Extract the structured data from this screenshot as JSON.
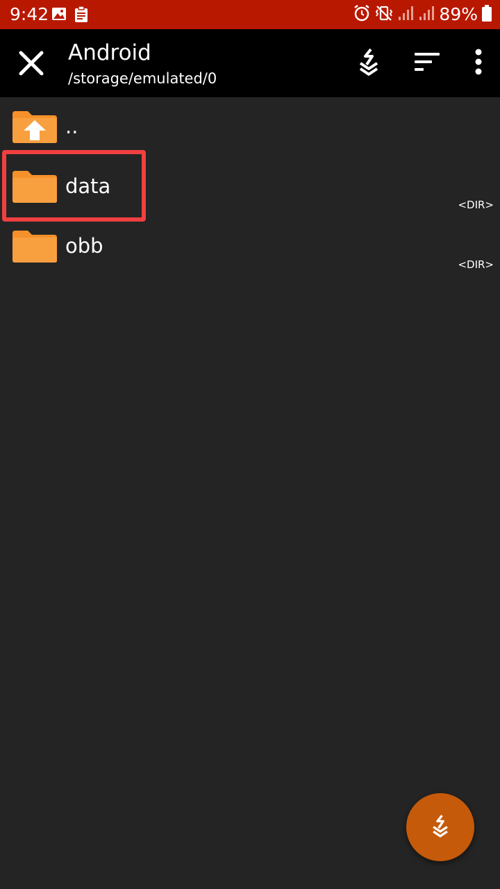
{
  "status_bar": {
    "time": "9:42",
    "battery": "89%",
    "left_icons": [
      "image-icon",
      "clipboard-icon"
    ],
    "right_icons": [
      "alarm-icon",
      "vibrate-icon",
      "signal-icon",
      "signal-icon",
      "battery-icon"
    ]
  },
  "app_bar": {
    "title": "Android",
    "subtitle": "/storage/emulated/0",
    "actions": [
      "download-icon",
      "sort-icon",
      "more-vert-icon"
    ]
  },
  "files": [
    {
      "name": "..",
      "type": "",
      "icon": "folder-up-icon"
    },
    {
      "name": "data",
      "type": "<DIR>",
      "icon": "folder-icon"
    },
    {
      "name": "obb",
      "type": "<DIR>",
      "icon": "folder-icon"
    }
  ],
  "colors": {
    "status_bar": "#b81800",
    "app_bar": "#000000",
    "background": "#242424",
    "folder": "#f5912a",
    "highlight": "#f04040",
    "fab": "#c55a0a"
  }
}
